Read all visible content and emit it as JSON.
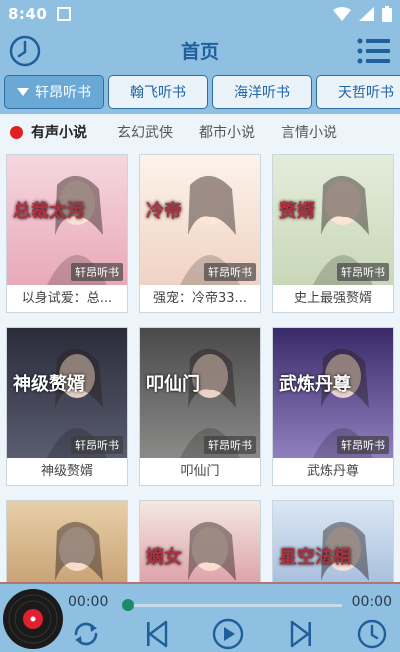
{
  "status": {
    "time": "8:40"
  },
  "header": {
    "title": "首页"
  },
  "stations": [
    {
      "label": "轩昂听书",
      "active": true
    },
    {
      "label": "翰飞听书",
      "active": false
    },
    {
      "label": "海洋听书",
      "active": false
    },
    {
      "label": "天哲听书",
      "active": false
    }
  ],
  "categories": [
    {
      "label": "有声小说",
      "active": true
    },
    {
      "label": "玄幻武侠"
    },
    {
      "label": "都市小说"
    },
    {
      "label": "言情小说"
    }
  ],
  "books": [
    {
      "title": "以身试爱：总...",
      "badge": "轩昂听书",
      "cover_text": "总裁太污",
      "palette": [
        "#f6d7df",
        "#e8a9b8"
      ]
    },
    {
      "title": "强宠：冷帝33...",
      "badge": "轩昂听书",
      "cover_text": "冷帝",
      "palette": [
        "#fdf3ea",
        "#f0d2c4"
      ]
    },
    {
      "title": "史上最强赘婿",
      "badge": "轩昂听书",
      "cover_text": "赘婿",
      "palette": [
        "#e4ecda",
        "#c9d7b8"
      ]
    },
    {
      "title": "神级赘婿",
      "badge": "轩昂听书",
      "cover_text": "神级赘婿",
      "palette": [
        "#2a2c3a",
        "#5a5c70"
      ]
    },
    {
      "title": "叩仙门",
      "badge": "轩昂听书",
      "cover_text": "叩仙门",
      "palette": [
        "#4a4a4c",
        "#8a8a88"
      ]
    },
    {
      "title": "武炼丹尊",
      "badge": "轩昂听书",
      "cover_text": "武炼丹尊",
      "palette": [
        "#3a2a6a",
        "#9080c0"
      ]
    },
    {
      "title": "",
      "badge": "",
      "cover_text": "",
      "palette": [
        "#e8cfa8",
        "#b88a5a"
      ]
    },
    {
      "title": "",
      "badge": "",
      "cover_text": "嫡女",
      "palette": [
        "#f4e8e2",
        "#d07a8a"
      ]
    },
    {
      "title": "",
      "badge": "",
      "cover_text": "星空法相",
      "palette": [
        "#dbe8f4",
        "#8aa8d0"
      ]
    }
  ],
  "player": {
    "elapsed": "00:00",
    "duration": "00:00",
    "progress": 0
  },
  "colors": {
    "bar": "#8fc0e2",
    "title": "#1f5f9a",
    "accent": "#e02020"
  },
  "icons": [
    "clock-icon",
    "menu-icon",
    "dropdown-triangle-icon",
    "vinyl-icon",
    "repeat-icon",
    "previous-icon",
    "play-icon",
    "next-icon",
    "timer-icon"
  ]
}
